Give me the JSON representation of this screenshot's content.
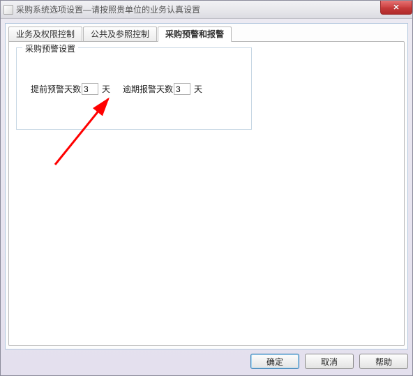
{
  "window": {
    "title": "采购系统选项设置—请按照贵单位的业务认真设置"
  },
  "tabs": [
    {
      "label": "业务及权限控制"
    },
    {
      "label": "公共及参照控制"
    },
    {
      "label": "采购预警和报警"
    }
  ],
  "activeTabIndex": 2,
  "group": {
    "title": "采购预警设置",
    "earlyLabel": "提前预警天数",
    "earlyValue": "3",
    "earlyUnit": "天",
    "overdueLabel": "逾期报警天数",
    "overdueValue": "3",
    "overdueUnit": "天"
  },
  "buttons": {
    "ok": "确定",
    "cancel": "取消",
    "help": "帮助"
  }
}
